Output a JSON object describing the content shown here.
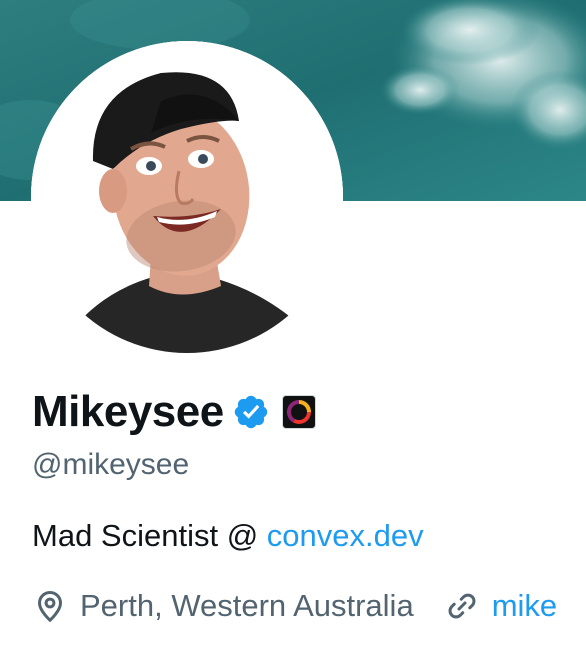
{
  "profile": {
    "display_name": "Mikeysee",
    "handle": "@mikeysee",
    "bio_prefix": "Mad Scientist @ ",
    "bio_link": "convex.dev",
    "location": "Perth, Western Australia",
    "website": "mike"
  },
  "icons": {
    "verified": "verified-badge-icon",
    "affiliate": "convex-affiliate-badge-icon",
    "location": "location-pin-icon",
    "link": "link-icon"
  },
  "colors": {
    "text_primary": "#0f1419",
    "text_secondary": "#536471",
    "link": "#1d9bf0",
    "verified": "#1d9bf0",
    "banner": "#2b8486"
  }
}
